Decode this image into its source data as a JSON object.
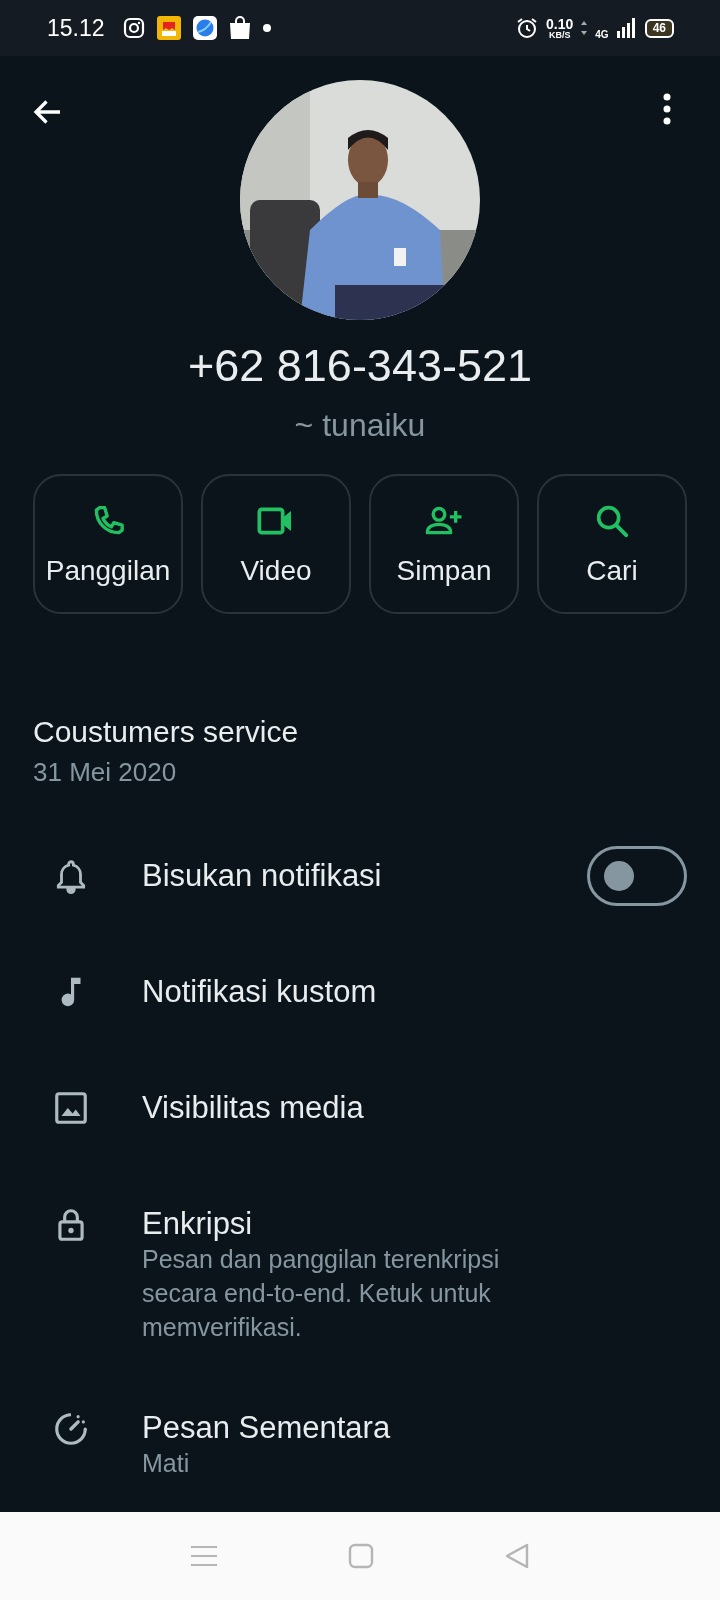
{
  "status_bar": {
    "time": "15.12",
    "data_speed": "0.10",
    "data_speed_unit": "KB/S",
    "network": "4G",
    "battery": "46"
  },
  "contact": {
    "phone": "+62 816-343-521",
    "push_name": "~ tunaiku"
  },
  "actions": [
    {
      "label": "Panggilan"
    },
    {
      "label": "Video"
    },
    {
      "label": "Simpan"
    },
    {
      "label": "Cari"
    }
  ],
  "about": {
    "text": "Coustumers service",
    "date": "31 Mei 2020"
  },
  "settings": [
    {
      "kind": "toggle",
      "label": "Bisukan notifikasi",
      "on": false
    },
    {
      "kind": "plain",
      "label": "Notifikasi kustom"
    },
    {
      "kind": "plain",
      "label": "Visibilitas media"
    },
    {
      "kind": "detail",
      "label": "Enkripsi",
      "subtitle": "Pesan dan panggilan terenkripsi secara end-to-end. Ketuk untuk memverifikasi."
    },
    {
      "kind": "detail",
      "label": "Pesan Sementara",
      "subtitle": "Mati"
    }
  ]
}
